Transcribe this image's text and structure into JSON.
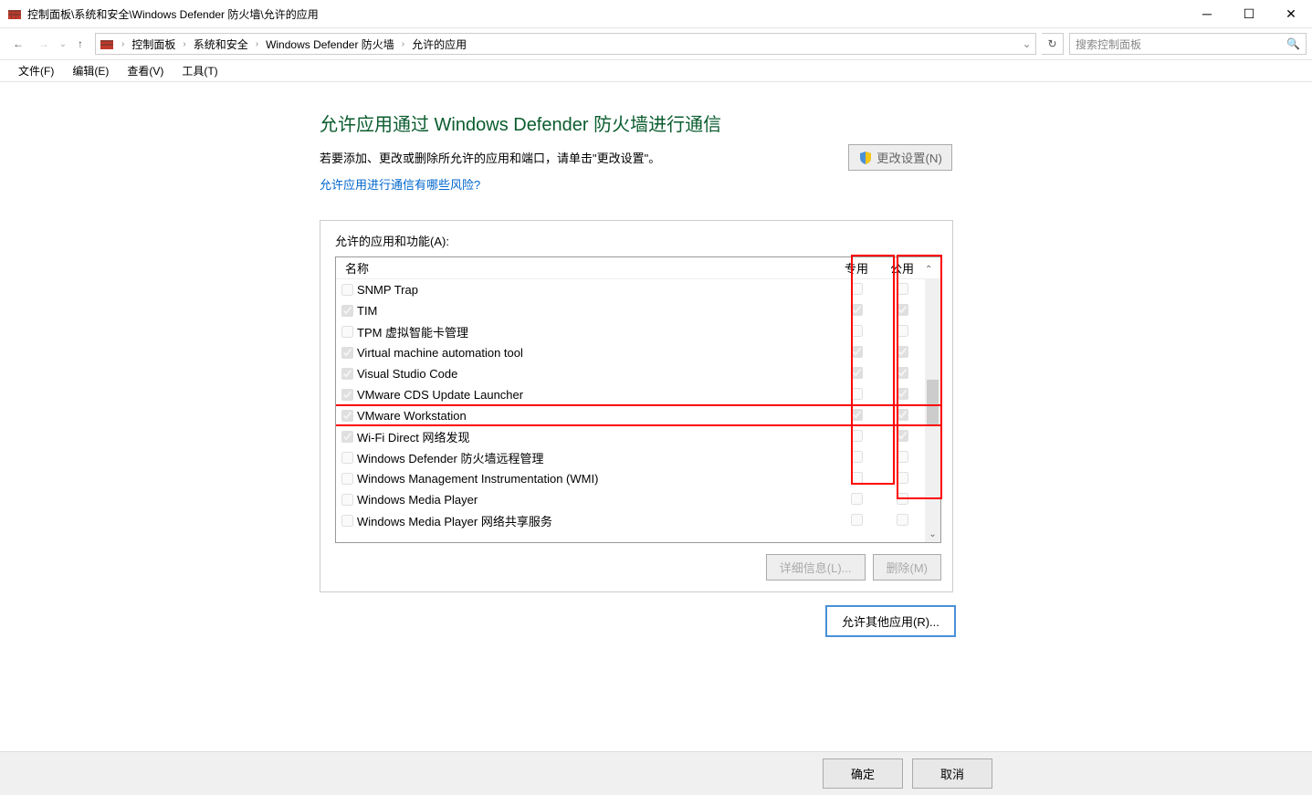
{
  "window": {
    "title": "控制面板\\系统和安全\\Windows Defender 防火墙\\允许的应用"
  },
  "breadcrumbs": [
    "控制面板",
    "系统和安全",
    "Windows Defender 防火墙",
    "允许的应用"
  ],
  "search": {
    "placeholder": "搜索控制面板"
  },
  "menu": {
    "file": "文件(F)",
    "edit": "编辑(E)",
    "view": "查看(V)",
    "tools": "工具(T)"
  },
  "page": {
    "title": "允许应用通过 Windows Defender 防火墙进行通信",
    "subtitle": "若要添加、更改或删除所允许的应用和端口，请单击\"更改设置\"。",
    "help_link": "允许应用进行通信有哪些风险?",
    "change_settings": "更改设置(N)",
    "list_label": "允许的应用和功能(A):",
    "col_name": "名称",
    "col_private": "专用",
    "col_public": "公用",
    "details_btn": "详细信息(L)...",
    "remove_btn": "删除(M)",
    "allow_other_btn": "允许其他应用(R)...",
    "ok": "确定",
    "cancel": "取消"
  },
  "apps": [
    {
      "enabled": false,
      "name": "SNMP Trap",
      "private": false,
      "public": false,
      "highlight": false
    },
    {
      "enabled": true,
      "name": "TIM",
      "private": true,
      "public": true,
      "highlight": false
    },
    {
      "enabled": false,
      "name": "TPM 虚拟智能卡管理",
      "private": false,
      "public": false,
      "highlight": false
    },
    {
      "enabled": true,
      "name": "Virtual machine automation tool",
      "private": true,
      "public": true,
      "highlight": false
    },
    {
      "enabled": true,
      "name": "Visual Studio Code",
      "private": true,
      "public": true,
      "highlight": false
    },
    {
      "enabled": true,
      "name": "VMware CDS Update Launcher",
      "private": false,
      "public": true,
      "highlight": false
    },
    {
      "enabled": true,
      "name": "VMware Workstation",
      "private": true,
      "public": true,
      "highlight": true
    },
    {
      "enabled": true,
      "name": "Wi-Fi Direct 网络发现",
      "private": false,
      "public": true,
      "highlight": false
    },
    {
      "enabled": false,
      "name": "Windows Defender 防火墙远程管理",
      "private": false,
      "public": false,
      "highlight": false
    },
    {
      "enabled": false,
      "name": "Windows Management Instrumentation (WMI)",
      "private": false,
      "public": false,
      "highlight": false
    },
    {
      "enabled": false,
      "name": "Windows Media Player",
      "private": false,
      "public": false,
      "highlight": false
    },
    {
      "enabled": false,
      "name": "Windows Media Player 网络共享服务",
      "private": false,
      "public": false,
      "highlight": false
    }
  ]
}
